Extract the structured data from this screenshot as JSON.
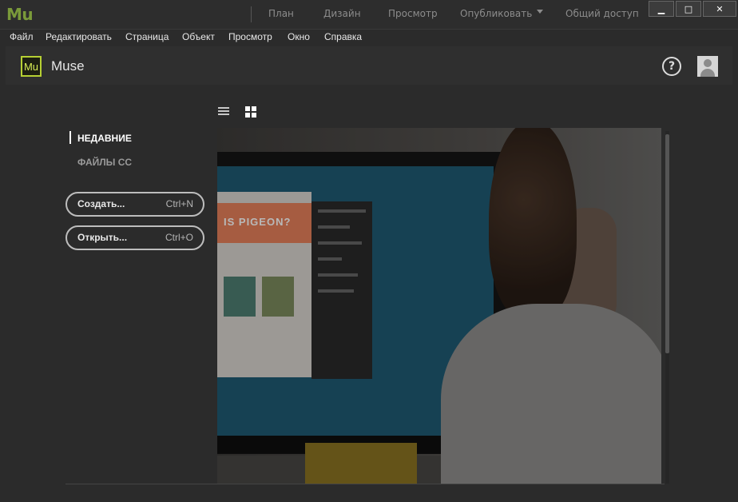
{
  "titlebar": {
    "app_logo": "Mu",
    "tabs": [
      {
        "label": "План"
      },
      {
        "label": "Дизайн"
      },
      {
        "label": "Просмотр"
      },
      {
        "label": "Опубликовать"
      },
      {
        "label": "Общий доступ"
      }
    ],
    "window_controls": {
      "minimize": "▁",
      "maximize": "□",
      "close": "✕"
    }
  },
  "menubar": {
    "items": [
      "Файл",
      "Редактировать",
      "Страница",
      "Объект",
      "Просмотр",
      "Окно",
      "Справка"
    ]
  },
  "header": {
    "badge": "Mu",
    "app_name": "Muse",
    "help": "?",
    "icons": [
      "help-icon",
      "user-avatar-icon"
    ]
  },
  "nav": {
    "items": [
      {
        "label": "НЕДАВНИЕ",
        "active": true
      },
      {
        "label": "ФАЙЛЫ CC",
        "active": false
      }
    ]
  },
  "actions": [
    {
      "label": "Создать...",
      "shortcut": "Ctrl+N"
    },
    {
      "label": "Открыть...",
      "shortcut": "Ctrl+O"
    }
  ],
  "view_toggles": [
    {
      "icon": "list-view-icon"
    },
    {
      "icon": "grid-view-icon",
      "active": true
    }
  ],
  "hero": {
    "screen_text": "IS PIGEON?"
  },
  "colors": {
    "background": "#2b2b2b",
    "titlebar": "#2d2d2d",
    "accent_muse": "#b6d033",
    "text_primary": "#ffffff",
    "text_muted": "#9a9a9a"
  }
}
